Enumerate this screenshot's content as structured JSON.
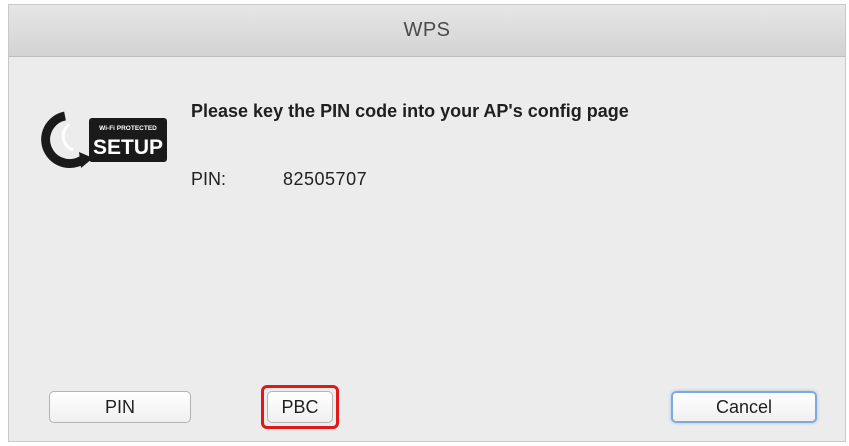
{
  "window": {
    "title": "WPS"
  },
  "logo": {
    "icon": "wifi-protected-setup-logo",
    "top_text": "Wi-Fi PROTECTED",
    "main_text": "SETUP"
  },
  "content": {
    "message": "Please key the PIN code into your AP's config page",
    "pin_label": "PIN:",
    "pin_value": "82505707"
  },
  "buttons": {
    "pin_label": "PIN",
    "pbc_label": "PBC",
    "cancel_label": "Cancel"
  },
  "colors": {
    "highlight": "#e01818",
    "default_button_border": "#7fa9dd"
  }
}
